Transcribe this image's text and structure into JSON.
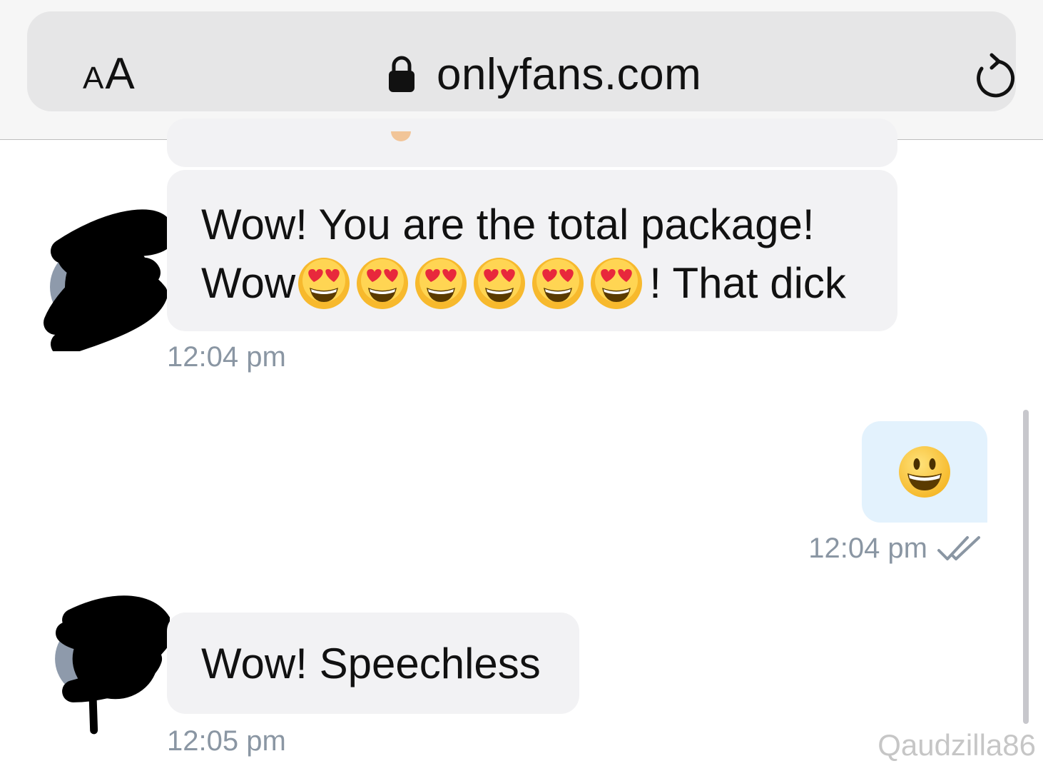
{
  "browser": {
    "text_size_small": "A",
    "text_size_big": "A",
    "url": "onlyfans.com"
  },
  "messages": [
    {
      "direction": "incoming",
      "line1": "Wow! You are the total package!",
      "line2_prefix": "Wow",
      "emoji": "heart-eyes",
      "emoji_count": 6,
      "line2_suffix": "! That dick",
      "time": "12:04 pm"
    },
    {
      "direction": "outgoing",
      "emoji": "grinning-face",
      "time": "12:04 pm",
      "status": "read"
    },
    {
      "direction": "incoming",
      "text": "Wow! Speechless",
      "time": "12:05 pm"
    }
  ],
  "watermark": "Qaudzilla86",
  "colors": {
    "incoming_bubble": "#f2f2f4",
    "outgoing_bubble": "#e3f2fd",
    "timestamp": "#8a96a3",
    "address_bar": "#e6e6e7"
  }
}
